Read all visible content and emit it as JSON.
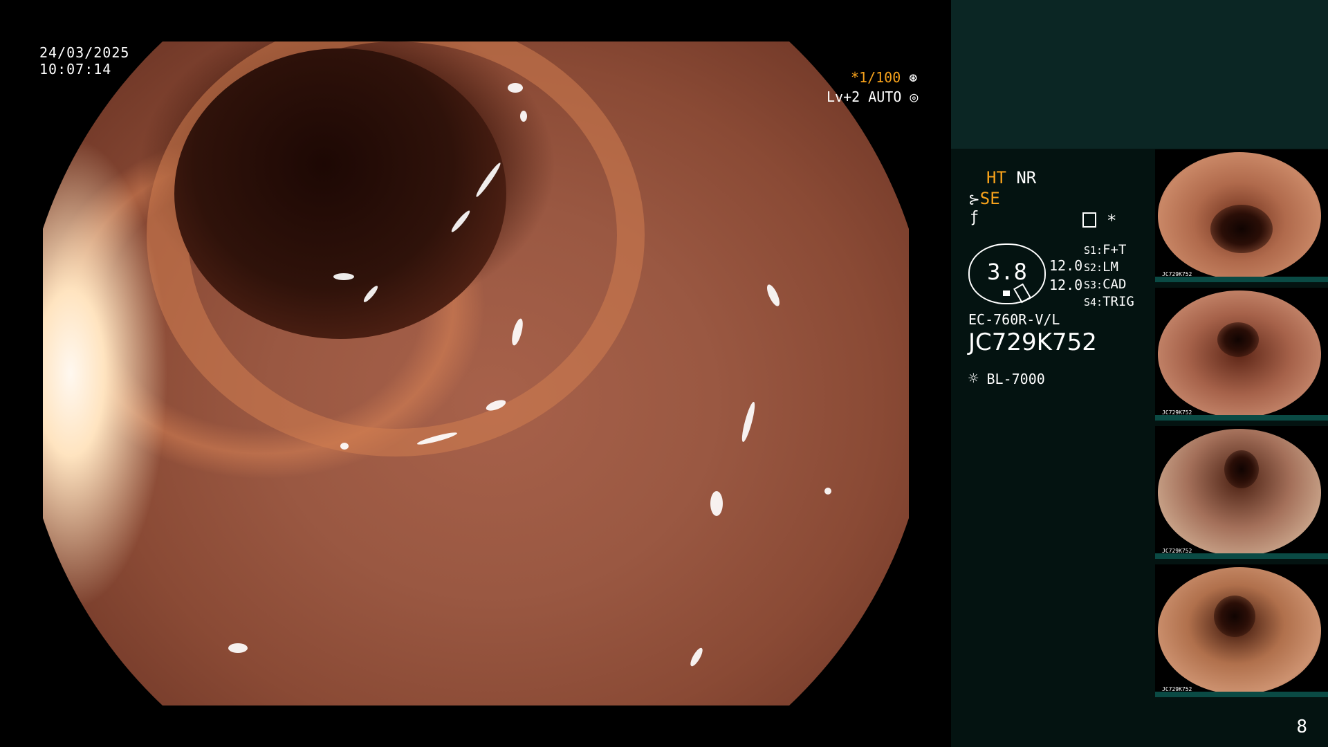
{
  "datetime": {
    "date": "24/03/2025",
    "time": "10:07:14"
  },
  "scope_overlay": {
    "shutter": "*1/100",
    "shutter_icon": "aperture-icon",
    "level": "Lv+2 AUTO",
    "level_icon": "iris-icon"
  },
  "panel": {
    "ht": "HT",
    "nr": "NR",
    "se": "SE",
    "se_icon": "scope-tip-icon",
    "freeze_icon": "slash-f-icon",
    "record_icon": "document-icon",
    "asterisk": "*",
    "gauge_value": "3.8",
    "value_top": "12.0",
    "value_bottom": "12.0",
    "switches": [
      {
        "key": "S1:",
        "value": "F+T"
      },
      {
        "key": "S2:",
        "value": "LM"
      },
      {
        "key": "S3:",
        "value": "CAD"
      },
      {
        "key": "S4:",
        "value": "TRIG"
      }
    ],
    "scope_model": "EC-760R-V/L",
    "serial": "JC729K752",
    "light_icon": "light-source-icon",
    "light_source": "BL-7000"
  },
  "thumbnails": [
    {
      "label": "JC729K752"
    },
    {
      "label": "JC729K752"
    },
    {
      "label": "JC729K752"
    },
    {
      "label": "JC729K752"
    }
  ],
  "page_number": "8",
  "colors": {
    "accent": "#f7a21b",
    "panel_bg": "#041311",
    "panel_top": "#0b2624"
  }
}
